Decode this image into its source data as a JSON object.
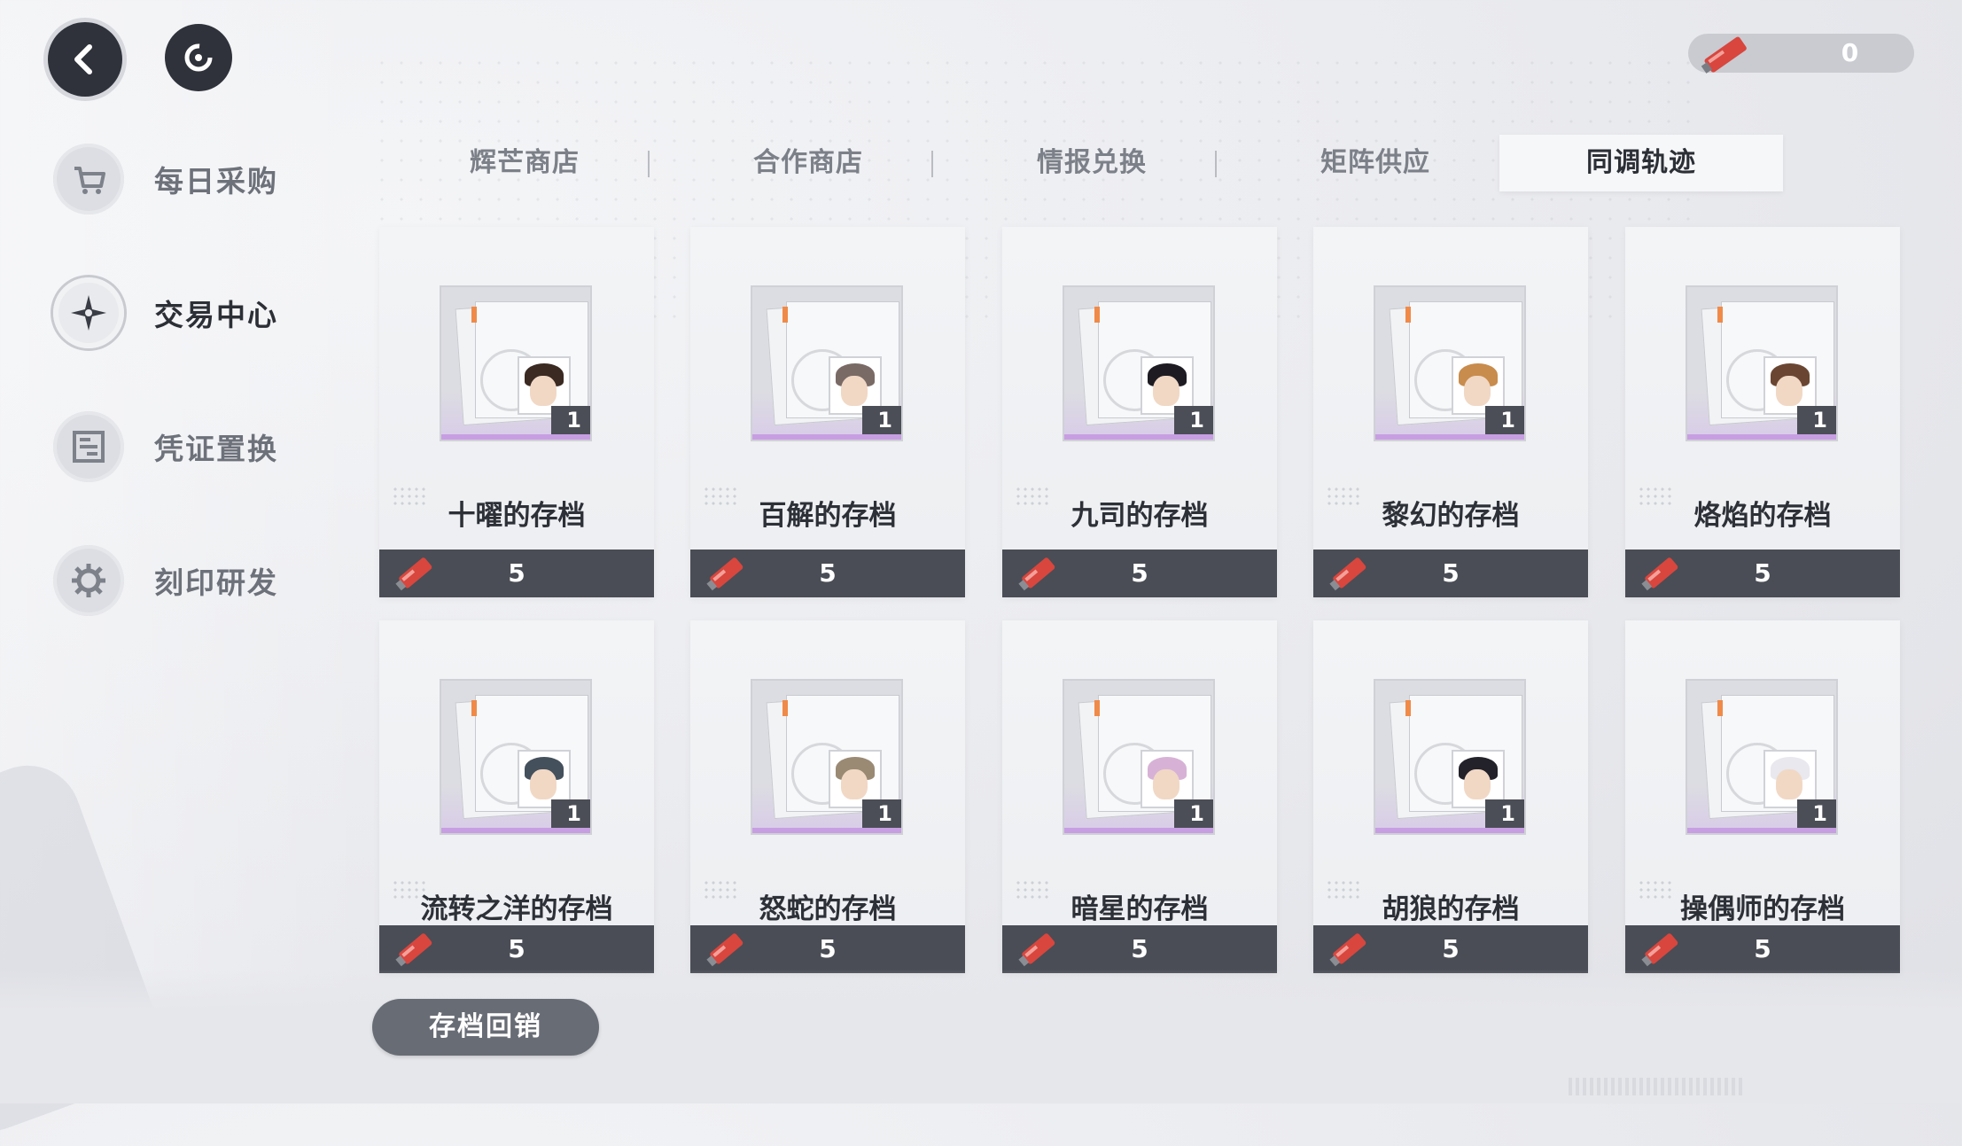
{
  "header": {
    "back_icon": "chevron-left-icon",
    "refresh_icon": "refresh-icon",
    "currency": {
      "icon": "data-stick-icon",
      "value": "0"
    }
  },
  "sidebar": {
    "items": [
      {
        "label": "每日采购",
        "icon": "shopping-cart-icon",
        "active": false
      },
      {
        "label": "交易中心",
        "icon": "compass-star-icon",
        "active": true
      },
      {
        "label": "凭证置换",
        "icon": "exchange-icon",
        "active": false
      },
      {
        "label": "刻印研发",
        "icon": "gear-icon",
        "active": false
      }
    ]
  },
  "tabs": [
    {
      "label": "辉芒商店",
      "active": false
    },
    {
      "label": "合作商店",
      "active": false
    },
    {
      "label": "情报兑换",
      "active": false
    },
    {
      "label": "矩阵供应",
      "active": false
    },
    {
      "label": "同调轨迹",
      "active": true
    }
  ],
  "cards": [
    {
      "title": "十曜的存档",
      "count": "1",
      "price": "5",
      "hair": "#3a2a22"
    },
    {
      "title": "百解的存档",
      "count": "1",
      "price": "5",
      "hair": "#7a6a66"
    },
    {
      "title": "九司的存档",
      "count": "1",
      "price": "5",
      "hair": "#1e1c22"
    },
    {
      "title": "黎幻的存档",
      "count": "1",
      "price": "5",
      "hair": "#c88c4c"
    },
    {
      "title": "烙焰的存档",
      "count": "1",
      "price": "5",
      "hair": "#6a4632"
    },
    {
      "title": "流转之洋的存档",
      "count": "1",
      "price": "5",
      "hair": "#44505c"
    },
    {
      "title": "怒蛇的存档",
      "count": "1",
      "price": "5",
      "hair": "#9a8a74"
    },
    {
      "title": "暗星的存档",
      "count": "1",
      "price": "5",
      "hair": "#d7b2d6"
    },
    {
      "title": "胡狼的存档",
      "count": "1",
      "price": "5",
      "hair": "#23222a"
    },
    {
      "title": "操偶师的存档",
      "count": "1",
      "price": "5",
      "hair": "#e8e8ee"
    }
  ],
  "footer": {
    "recycle_label": "存档回销"
  },
  "colors": {
    "accent_purple": "#c79ee2",
    "dark_bar": "#4a4d55",
    "currency_red": "#d8463e"
  }
}
